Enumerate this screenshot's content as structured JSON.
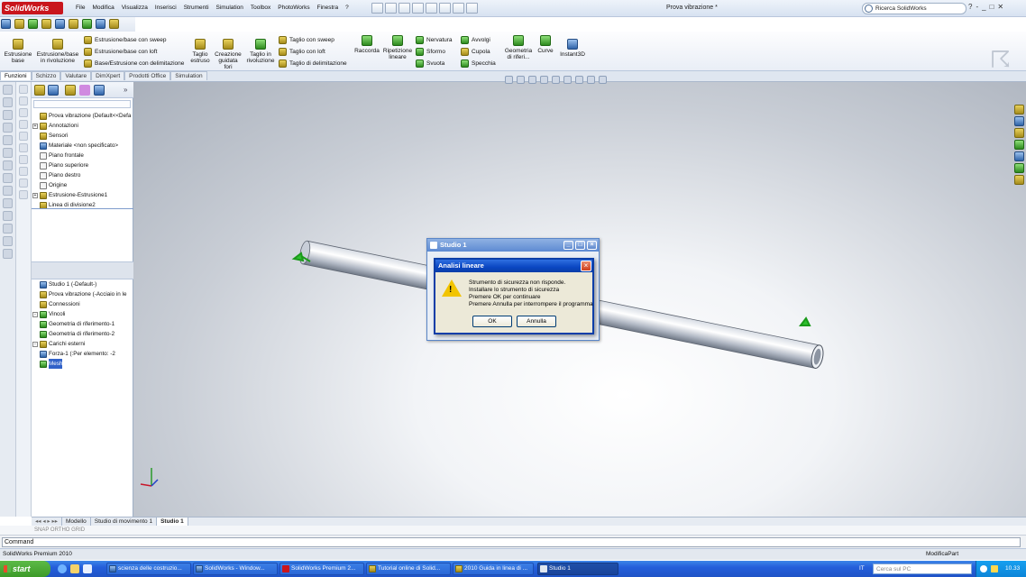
{
  "app": {
    "logo": "SolidWorks",
    "doc_title": "Prova vibrazione *"
  },
  "menu": [
    "File",
    "Modifica",
    "Visualizza",
    "Inserisci",
    "Strumenti",
    "Simulation",
    "Toolbox",
    "PhotoWorks",
    "Finestra",
    "?"
  ],
  "search": {
    "value": "Ricerca SolidWorks"
  },
  "window_buttons": [
    "?",
    "-",
    "_",
    "□",
    "✕"
  ],
  "ribbon": {
    "estrusione_base": "Estrusione\nbase",
    "estrusione_rivoluzione": "Estrusione/base\nin rivoluzione",
    "estrusione_sweep": "Estrusione/base con sweep",
    "estrusione_loft": "Estrusione/base con loft",
    "estrusione_delimitazione": "Base/Estrusione con delimitazione",
    "taglio_estruso": "Taglio\nestruso",
    "creazione_guidata_fori": "Creazione\nguidata\nfori",
    "taglio_rivoluzione": "Taglio in\nrivoluzione",
    "taglio_sweep": "Taglio con sweep",
    "taglio_loft": "Taglio con loft",
    "taglio_delimitazione": "Taglio di delimitazione",
    "raccorda": "Raccorda",
    "ripetizione_lineare": "Ripetizione\nlineare",
    "nervatura": "Nervatura",
    "sformo": "Sformo",
    "svuota": "Svuota",
    "avvolgi": "Avvolgi",
    "cupola": "Cupola",
    "specchia": "Specchia",
    "geometria_riferimento": "Geometria\ndi riferi...",
    "curve": "Curve",
    "instant3d": "Instant3D"
  },
  "tabs": [
    "Funzioni",
    "Schizzo",
    "Valutare",
    "DimXpert",
    "Prodotti Office",
    "Simulation"
  ],
  "feature_tree": [
    {
      "label": "Prova vibrazione  (Default<<Defa",
      "icon": "part-icon",
      "exp": ""
    },
    {
      "label": "Annotazioni",
      "icon": "annotations-icon",
      "exp": "+"
    },
    {
      "label": "Sensori",
      "icon": "sensor-icon",
      "exp": ""
    },
    {
      "label": "Materiale <non specificato>",
      "icon": "material-icon",
      "exp": ""
    },
    {
      "label": "Piano frontale",
      "icon": "plane-icon",
      "exp": ""
    },
    {
      "label": "Piano superiore",
      "icon": "plane-icon",
      "exp": ""
    },
    {
      "label": "Piano destro",
      "icon": "plane-icon",
      "exp": ""
    },
    {
      "label": "Origine",
      "icon": "origin-icon",
      "exp": ""
    },
    {
      "label": "Estrusione-Estrusione1",
      "icon": "extrude-icon",
      "exp": "+"
    },
    {
      "label": "Linea di divisione2",
      "icon": "split-line-icon",
      "exp": ""
    }
  ],
  "study_tree": [
    {
      "label": "Studio 1 (-Default-)",
      "icon": "study-icon",
      "exp": ""
    },
    {
      "label": "Prova vibrazione (-Acciaio in le",
      "icon": "part-icon",
      "exp": ""
    },
    {
      "label": "Connessioni",
      "icon": "connection-icon",
      "exp": ""
    },
    {
      "label": "Vincoli",
      "icon": "fixture-icon",
      "exp": "-"
    },
    {
      "label": "Geometria di riferimento-1",
      "icon": "fixture-icon",
      "exp": ""
    },
    {
      "label": "Geometria di riferimento-2",
      "icon": "fixture-icon",
      "exp": ""
    },
    {
      "label": "Carichi esterni",
      "icon": "load-icon",
      "exp": "-"
    },
    {
      "label": "Forza-1 (:Per elemento: -2",
      "icon": "force-icon",
      "exp": ""
    },
    {
      "label": "Mesh",
      "icon": "mesh-icon",
      "exp": ""
    }
  ],
  "bottom_tabs": [
    "Modello",
    "Studio di movimento 1",
    "Studio 1"
  ],
  "snap_text": "SNAP ORTHO GRID",
  "command": {
    "value": "Command"
  },
  "status": {
    "left": "SolidWorks Premium 2010",
    "right": "ModificaPart"
  },
  "dialog_studio": {
    "title": "Studio 1"
  },
  "dialog_analisi": {
    "title": "Analisi lineare",
    "lines": [
      "Strumento di sicurezza non risponde.",
      "Installare lo strumento di sicurezza",
      "Premere OK per continuare",
      "Premere Annulla per interrompere il programma"
    ],
    "ok": "OK",
    "cancel": "Annulla"
  },
  "taskbar": {
    "start": "start",
    "items": [
      "scienza delle costruzio...",
      "SolidWorks - Window...",
      "SolidWorks Premium 2...",
      "Tutorial online di Solid...",
      "2010 Guida in linea di ...",
      "Studio 1"
    ],
    "lang": "IT",
    "pc_search": "Cerca sul PC",
    "clock": "10.33"
  },
  "colors": {
    "accent": "#0a46c2",
    "warning": "#f2c400",
    "taskbar": "#245edb"
  }
}
